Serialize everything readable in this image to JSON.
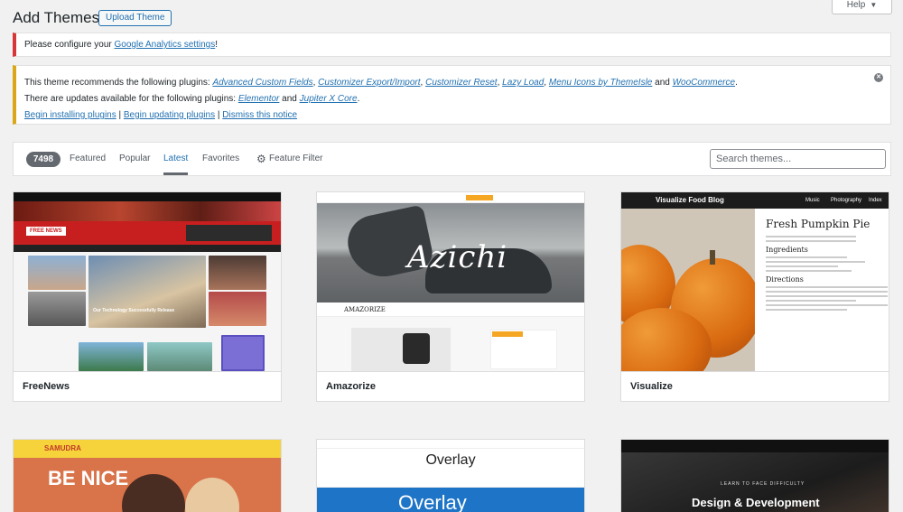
{
  "header": {
    "title": "Add Themes",
    "upload_label": "Upload Theme",
    "help_label": "Help"
  },
  "notice_error": {
    "text_before": "Please configure your ",
    "link": "Google Analytics settings",
    "text_after": "!"
  },
  "notice_warning": {
    "line1_prefix": "This theme recommends the following plugins: ",
    "recommended_plugins": [
      "Advanced Custom Fields",
      "Customizer Export/Import",
      "Customizer Reset",
      "Lazy Load",
      "Menu Icons by ThemeIsle",
      "WooCommerce"
    ],
    "line2_prefix": "There are updates available for the following plugins: ",
    "update_plugins": [
      "Elementor",
      "Jupiter X Core"
    ],
    "and": "and",
    "actions": [
      "Begin installing plugins",
      "Begin updating plugins",
      "Dismiss this notice"
    ]
  },
  "filter_bar": {
    "count": "7498",
    "tabs": [
      "Featured",
      "Popular",
      "Latest",
      "Favorites"
    ],
    "active_tab": "Latest",
    "feature_filter": "Feature Filter",
    "search_placeholder": "Search themes..."
  },
  "themes": [
    {
      "name": "FreeNews",
      "preview": {
        "logo": "FREE NEWS",
        "headline": "Our Technology Successfully Release"
      }
    },
    {
      "name": "Amazorize",
      "preview": {
        "hero_text": "Azichi",
        "brand": "AMAZORIZE"
      }
    },
    {
      "name": "Visualize",
      "preview": {
        "blog_title": "Visualize Food Blog",
        "post_title": "Fresh Pumpkin Pie",
        "section1": "Ingredients",
        "section2": "Directions",
        "menu": [
          "Music",
          "Photography",
          "Index"
        ]
      }
    }
  ],
  "themes_row2": [
    {
      "preview": {
        "logo": "SAMUDRA",
        "hero": "BE NICE"
      }
    },
    {
      "preview": {
        "title": "Overlay",
        "hero": "Overlay"
      }
    },
    {
      "preview": {
        "kicker": "LEARN TO FACE DIFFICULTY",
        "headline": "Design & Development"
      }
    }
  ],
  "colors": {
    "accent": "#2271b1",
    "error": "#d63638",
    "warning": "#dba617"
  }
}
